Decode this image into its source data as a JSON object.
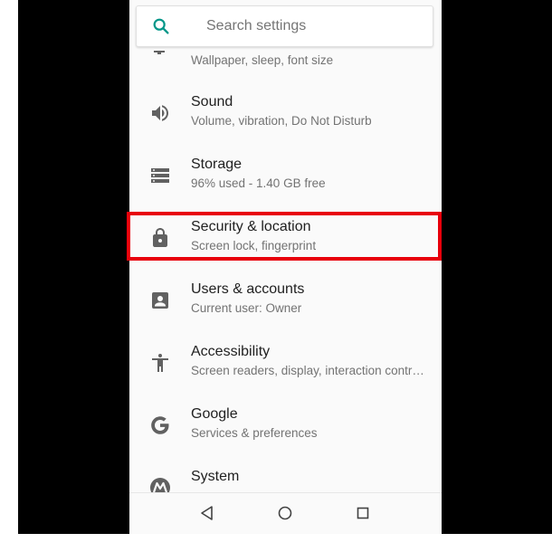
{
  "search": {
    "placeholder": "Search settings",
    "icon": "search-icon",
    "accent": "#009688"
  },
  "partial_item": {
    "subtitle": "Wallpaper, sleep, font size",
    "icon": "display-icon"
  },
  "items": [
    {
      "id": "sound",
      "title": "Sound",
      "subtitle": "Volume, vibration, Do Not Disturb",
      "icon": "volume-icon"
    },
    {
      "id": "storage",
      "title": "Storage",
      "subtitle": "96% used - 1.40 GB free",
      "icon": "storage-icon"
    },
    {
      "id": "security",
      "title": "Security & location",
      "subtitle": "Screen lock, fingerprint",
      "icon": "lock-icon",
      "highlighted": true
    },
    {
      "id": "users",
      "title": "Users & accounts",
      "subtitle": "Current user: Owner",
      "icon": "account-box-icon"
    },
    {
      "id": "accessibility",
      "title": "Accessibility",
      "subtitle": "Screen readers, display, interaction contr…",
      "icon": "accessibility-icon"
    },
    {
      "id": "google",
      "title": "Google",
      "subtitle": "Services & preferences",
      "icon": "google-g-icon"
    },
    {
      "id": "system",
      "title": "System",
      "subtitle": "",
      "icon": "motorola-icon"
    }
  ],
  "navbar": {
    "back_icon": "back-triangle-icon",
    "home_icon": "home-circle-icon",
    "recents_icon": "recents-square-icon"
  },
  "colors": {
    "icon_gray": "#616161",
    "highlight_red": "#e8000b",
    "background": "#fafafa"
  }
}
